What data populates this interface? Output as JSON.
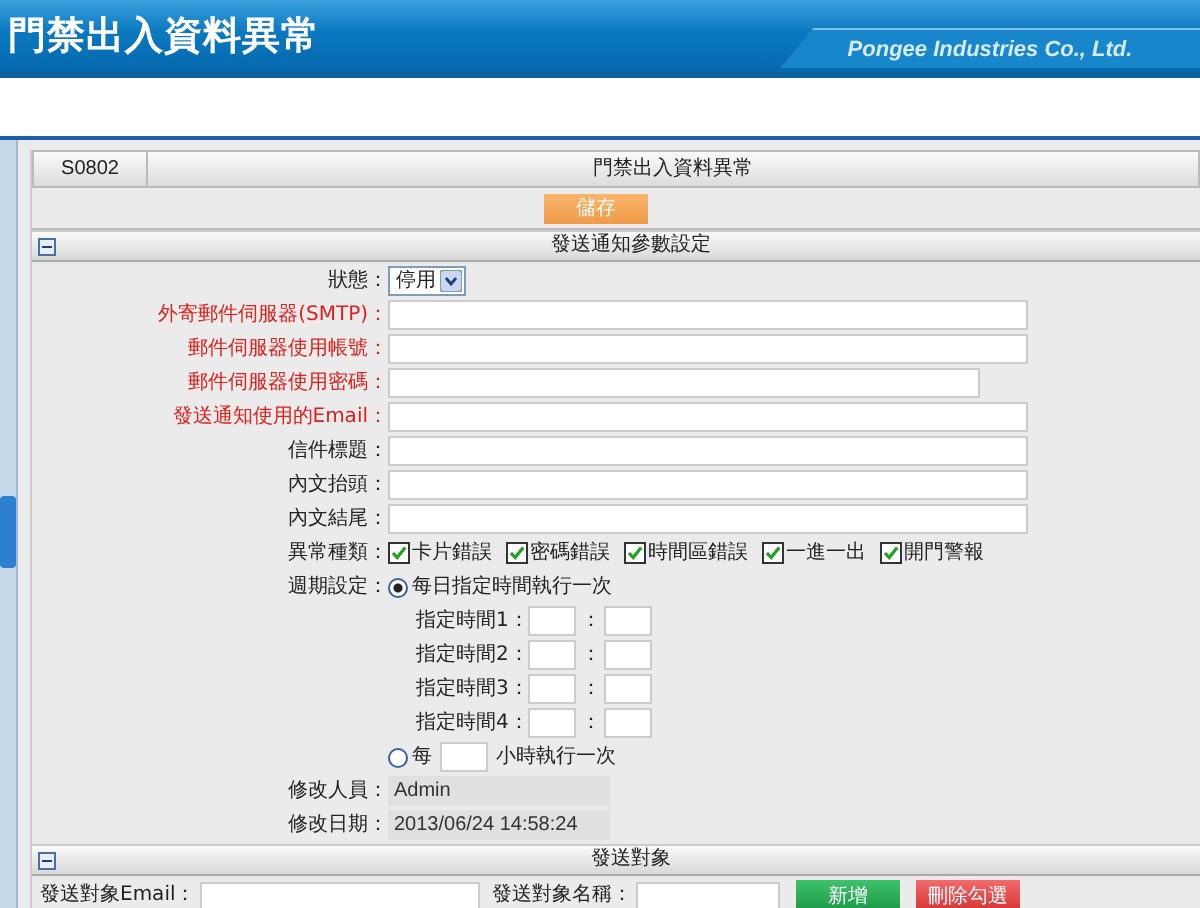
{
  "banner": {
    "title": "門禁出入資料異常",
    "company": "Pongee Industries Co., Ltd."
  },
  "panel": {
    "code": "S0802",
    "title": "門禁出入資料異常",
    "save_button": "儲存"
  },
  "settings_section": {
    "title": "發送通知參數設定",
    "expanded": true
  },
  "fields": [
    {
      "kind": "select",
      "label": "狀態：",
      "required": false,
      "value": "停用"
    },
    {
      "kind": "text",
      "label": "外寄郵件伺服器(SMTP)：",
      "required": true,
      "narrow": false
    },
    {
      "kind": "text",
      "label": "郵件伺服器使用帳號：",
      "required": true,
      "narrow": false
    },
    {
      "kind": "text",
      "label": "郵件伺服器使用密碼：",
      "required": true,
      "narrow": true
    },
    {
      "kind": "text",
      "label": "發送通知使用的Email：",
      "required": true,
      "narrow": false
    },
    {
      "kind": "text",
      "label": "信件標題：",
      "required": false,
      "narrow": false
    },
    {
      "kind": "text",
      "label": "內文抬頭：",
      "required": false,
      "narrow": false
    },
    {
      "kind": "text",
      "label": "內文結尾：",
      "required": false,
      "narrow": false
    },
    {
      "kind": "checkboxes",
      "label": "異常種類：",
      "required": false,
      "options": [
        {
          "label": "卡片錯誤",
          "checked": true
        },
        {
          "label": "密碼錯誤",
          "checked": true
        },
        {
          "label": "時間區錯誤",
          "checked": true
        },
        {
          "label": "一進一出",
          "checked": true
        },
        {
          "label": "開門警報",
          "checked": true
        }
      ]
    },
    {
      "kind": "schedule",
      "label": "週期設定：",
      "required": false,
      "daily": {
        "label": "每日指定時間執行一次",
        "selected": true,
        "separator": "：",
        "times": [
          "指定時間1：",
          "指定時間2：",
          "指定時間3：",
          "指定時間4："
        ]
      },
      "hourly": {
        "prefix": "每",
        "suffix": "小時執行一次",
        "selected": false
      }
    },
    {
      "kind": "readonly",
      "label": "修改人員：",
      "required": false,
      "value": "Admin"
    },
    {
      "kind": "readonly",
      "label": "修改日期：",
      "required": false,
      "value": "2013/06/24 14:58:24"
    }
  ],
  "recipients_section": {
    "title": "發送對象",
    "expanded": true
  },
  "recipients": {
    "email_label": "發送對象Email：",
    "name_label": "發送對象名稱：",
    "add_button": "新增",
    "delete_button": "刪除勾選"
  }
}
